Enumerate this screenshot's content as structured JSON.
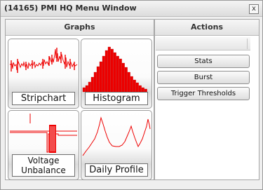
{
  "window": {
    "title": "(14165) PMI HQ Menu Window",
    "close_glyph": "x"
  },
  "graphs": {
    "header": "Graphs",
    "tiles": [
      {
        "label": "Stripchart",
        "icon": "stripchart-icon"
      },
      {
        "label": "Histogram",
        "icon": "histogram-icon"
      },
      {
        "label": "Voltage Unbalance",
        "icon": "voltage-unbalance-icon"
      },
      {
        "label": "Daily Profile",
        "icon": "daily-profile-icon"
      }
    ]
  },
  "actions": {
    "header": "Actions",
    "buttons": [
      {
        "label": "Stats"
      },
      {
        "label": "Burst"
      },
      {
        "label": "Trigger Thresholds"
      }
    ]
  },
  "colors": {
    "trace": "#ee0000",
    "border": "#9c9c9c",
    "panel_header": "#e2e2e2"
  }
}
